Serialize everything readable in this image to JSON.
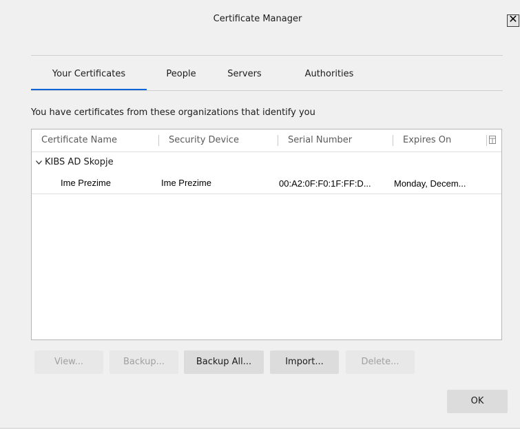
{
  "window": {
    "title": "Certificate Manager",
    "close_label": "✕"
  },
  "tabs": [
    {
      "label": "Your Certificates",
      "active": true
    },
    {
      "label": "People",
      "active": false
    },
    {
      "label": "Servers",
      "active": false
    },
    {
      "label": "Authorities",
      "active": false
    }
  ],
  "intro_text": "You have certificates from these organizations that identify you",
  "table": {
    "columns": [
      "Certificate Name",
      "Security Device",
      "Serial Number",
      "Expires On"
    ],
    "groups": [
      {
        "name": "KIBS AD Skopje",
        "expanded": true,
        "rows": [
          {
            "certificate_name": "Ime Prezime",
            "security_device": "Ime Prezime",
            "serial_number": "00:A2:0F:F0:1F:FF:D...",
            "expires_on": "Monday, Decem..."
          }
        ]
      }
    ]
  },
  "buttons": {
    "view": {
      "label": "View...",
      "enabled": false
    },
    "backup": {
      "label": "Backup...",
      "enabled": false
    },
    "backup_all": {
      "label": "Backup All...",
      "enabled": true
    },
    "import": {
      "label": "Import...",
      "enabled": true
    },
    "delete": {
      "label": "Delete...",
      "enabled": false
    },
    "ok": {
      "label": "OK",
      "enabled": true
    }
  },
  "colors": {
    "accent": "#0a64d8",
    "dialog_bg": "#f0f0f0",
    "button_bg": "#dcdcdc",
    "disabled_text": "#a0a0a0"
  }
}
